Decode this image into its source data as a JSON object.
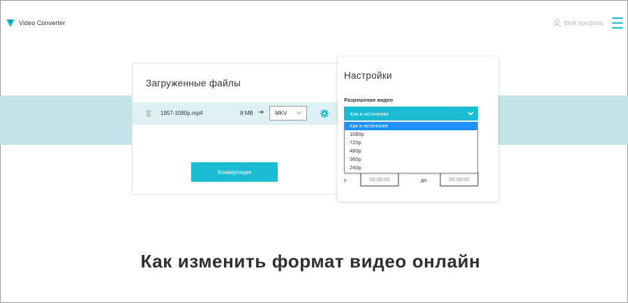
{
  "header": {
    "brand": "Video Converter",
    "profile_label": "Мой профиль"
  },
  "files": {
    "title": "Загруженные файлы",
    "file_name": "1957-1080p.mp4",
    "file_size": "8 MB",
    "format_value": "MKV",
    "convert_label": "Конвертация"
  },
  "settings": {
    "title": "Настройки",
    "resolution_label": "Разрешение видео",
    "resolution_value": "Как в источнике",
    "resolution_options": [
      "Как в источнике",
      "1080p",
      "720p",
      "480p",
      "360p",
      "240p"
    ],
    "time_from_label": "с",
    "time_to_label": "до",
    "time_from_value": "00:00:00",
    "time_to_value": "00:00:00"
  },
  "headline": "Как изменить формат видео онлайн",
  "colors": {
    "accent": "#1bbbd4",
    "band": "#c4e4ea",
    "row": "#dff1f4",
    "selected_option": "#1e90ff"
  }
}
